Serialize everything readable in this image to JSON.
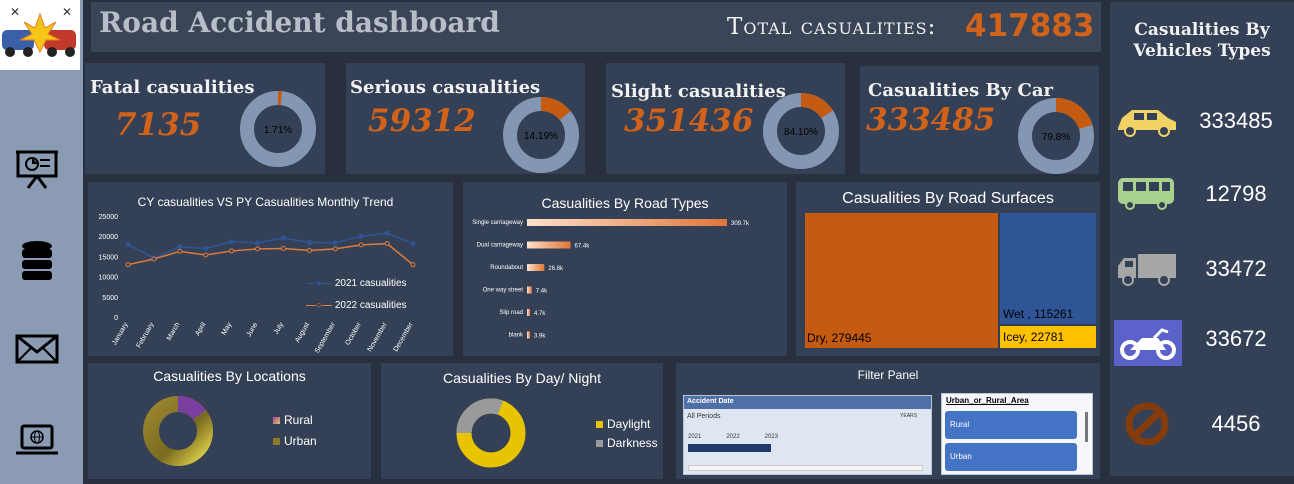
{
  "header": {
    "title": "Road Accident dashboard",
    "total_label": "Total casualities:",
    "total_value": "417883"
  },
  "sidebar": {
    "icons": [
      "crash-logo-icon",
      "presentation-icon",
      "database-icon",
      "mail-icon",
      "laptop-globe-icon"
    ]
  },
  "kpis": [
    {
      "title": "Fatal casualities",
      "value": "7135",
      "pct_label": "1.71%",
      "pct": 1.71
    },
    {
      "title": "Serious  casualities",
      "value": "59312",
      "pct_label": "14.19%",
      "pct": 14.19
    },
    {
      "title": "Slight casualities",
      "value": "351436",
      "pct_label": "84.10%",
      "pct": 84.1
    },
    {
      "title": "Casualities By Car",
      "value": "333485",
      "pct_label": "79.8%",
      "pct": 79.8
    }
  ],
  "vehicles": {
    "title": "Casualities By Vehicles Types",
    "items": [
      {
        "icon": "car-icon",
        "value": "333485"
      },
      {
        "icon": "bus-icon",
        "value": "12798"
      },
      {
        "icon": "truck-icon",
        "value": "33472"
      },
      {
        "icon": "motorcycle-icon",
        "value": "33672"
      },
      {
        "icon": "prohibited-icon",
        "value": "4456"
      }
    ]
  },
  "trend": {
    "title": "CY casualities VS PY Casualities Monthly Trend",
    "legend": [
      "2021 casualities",
      "2022 casualities"
    ]
  },
  "road_types": {
    "title": "Casualities By Road Types"
  },
  "surfaces": {
    "title": "Casualities By Road Surfaces"
  },
  "locations": {
    "title": "Casualities By  Locations",
    "legend": [
      "Rural",
      "Urban"
    ]
  },
  "day_night": {
    "title": "Casualities By Day/ Night",
    "legend": [
      "Daylight",
      "Darkness"
    ]
  },
  "filter": {
    "title": "Filter Panel",
    "date_slicer": {
      "header": "Accident Date",
      "period": "All Periods",
      "unit": "YEARS",
      "years": [
        "2021",
        "2022",
        "2023"
      ]
    },
    "area_slicer": {
      "header": "Urban_or_Rural_Area",
      "options": [
        "Rural",
        "Urban"
      ]
    }
  },
  "chart_data": [
    {
      "type": "line",
      "title": "CY casualities VS PY Casualities Monthly Trend",
      "categories": [
        "January",
        "February",
        "March",
        "April",
        "May",
        "June",
        "July",
        "August",
        "September",
        "October",
        "November",
        "December"
      ],
      "y_ticks": [
        "25000",
        "20000",
        "15000",
        "10000",
        "5000",
        "0"
      ],
      "ylim": [
        0,
        25000
      ],
      "series": [
        {
          "name": "2021 casualities",
          "color": "#2f5597",
          "values": [
            18200,
            14800,
            17600,
            17200,
            18900,
            18600,
            19800,
            18700,
            18600,
            20200,
            21000,
            18400
          ]
        },
        {
          "name": "2022 casualities",
          "color": "#e07b39",
          "values": [
            13200,
            14600,
            16500,
            15600,
            16600,
            17100,
            17200,
            16700,
            17100,
            18100,
            18400,
            13200
          ]
        }
      ],
      "legend": "bottom-right"
    },
    {
      "type": "bar",
      "orientation": "horizontal",
      "title": "Casualities By Road Types",
      "categories": [
        "Single carriageway",
        "Dual carriageway",
        "Roundabout",
        "One way street",
        "Slip road",
        "blank"
      ],
      "values": [
        309.7,
        67.4,
        26.8,
        7.4,
        4.7,
        3.9
      ],
      "labels": [
        "309.7k",
        "67.4k",
        "26.8k",
        "7.4k",
        "4.7k",
        "3.9k"
      ]
    },
    {
      "type": "treemap",
      "title": "Casualities By Road Surfaces",
      "items": [
        {
          "label": "Dry, 279445",
          "value": 279445,
          "color": "#c55a11"
        },
        {
          "label": "Wet , 115261",
          "value": 115261,
          "color": "#2f5597"
        },
        {
          "label": "Icey, 22781",
          "value": 22781,
          "color": "#ffc000"
        }
      ]
    },
    {
      "type": "pie",
      "title": "Casualities By  Locations",
      "series": [
        {
          "name": "Rural",
          "color": "#d4c85a"
        },
        {
          "name": "Urban",
          "color": "#8a7a2a"
        }
      ]
    },
    {
      "type": "pie",
      "title": "Casualities By Day/ Night",
      "series": [
        {
          "name": "Daylight",
          "color": "#e8c300"
        },
        {
          "name": "Darkness",
          "color": "#8c8c8c"
        }
      ]
    }
  ]
}
